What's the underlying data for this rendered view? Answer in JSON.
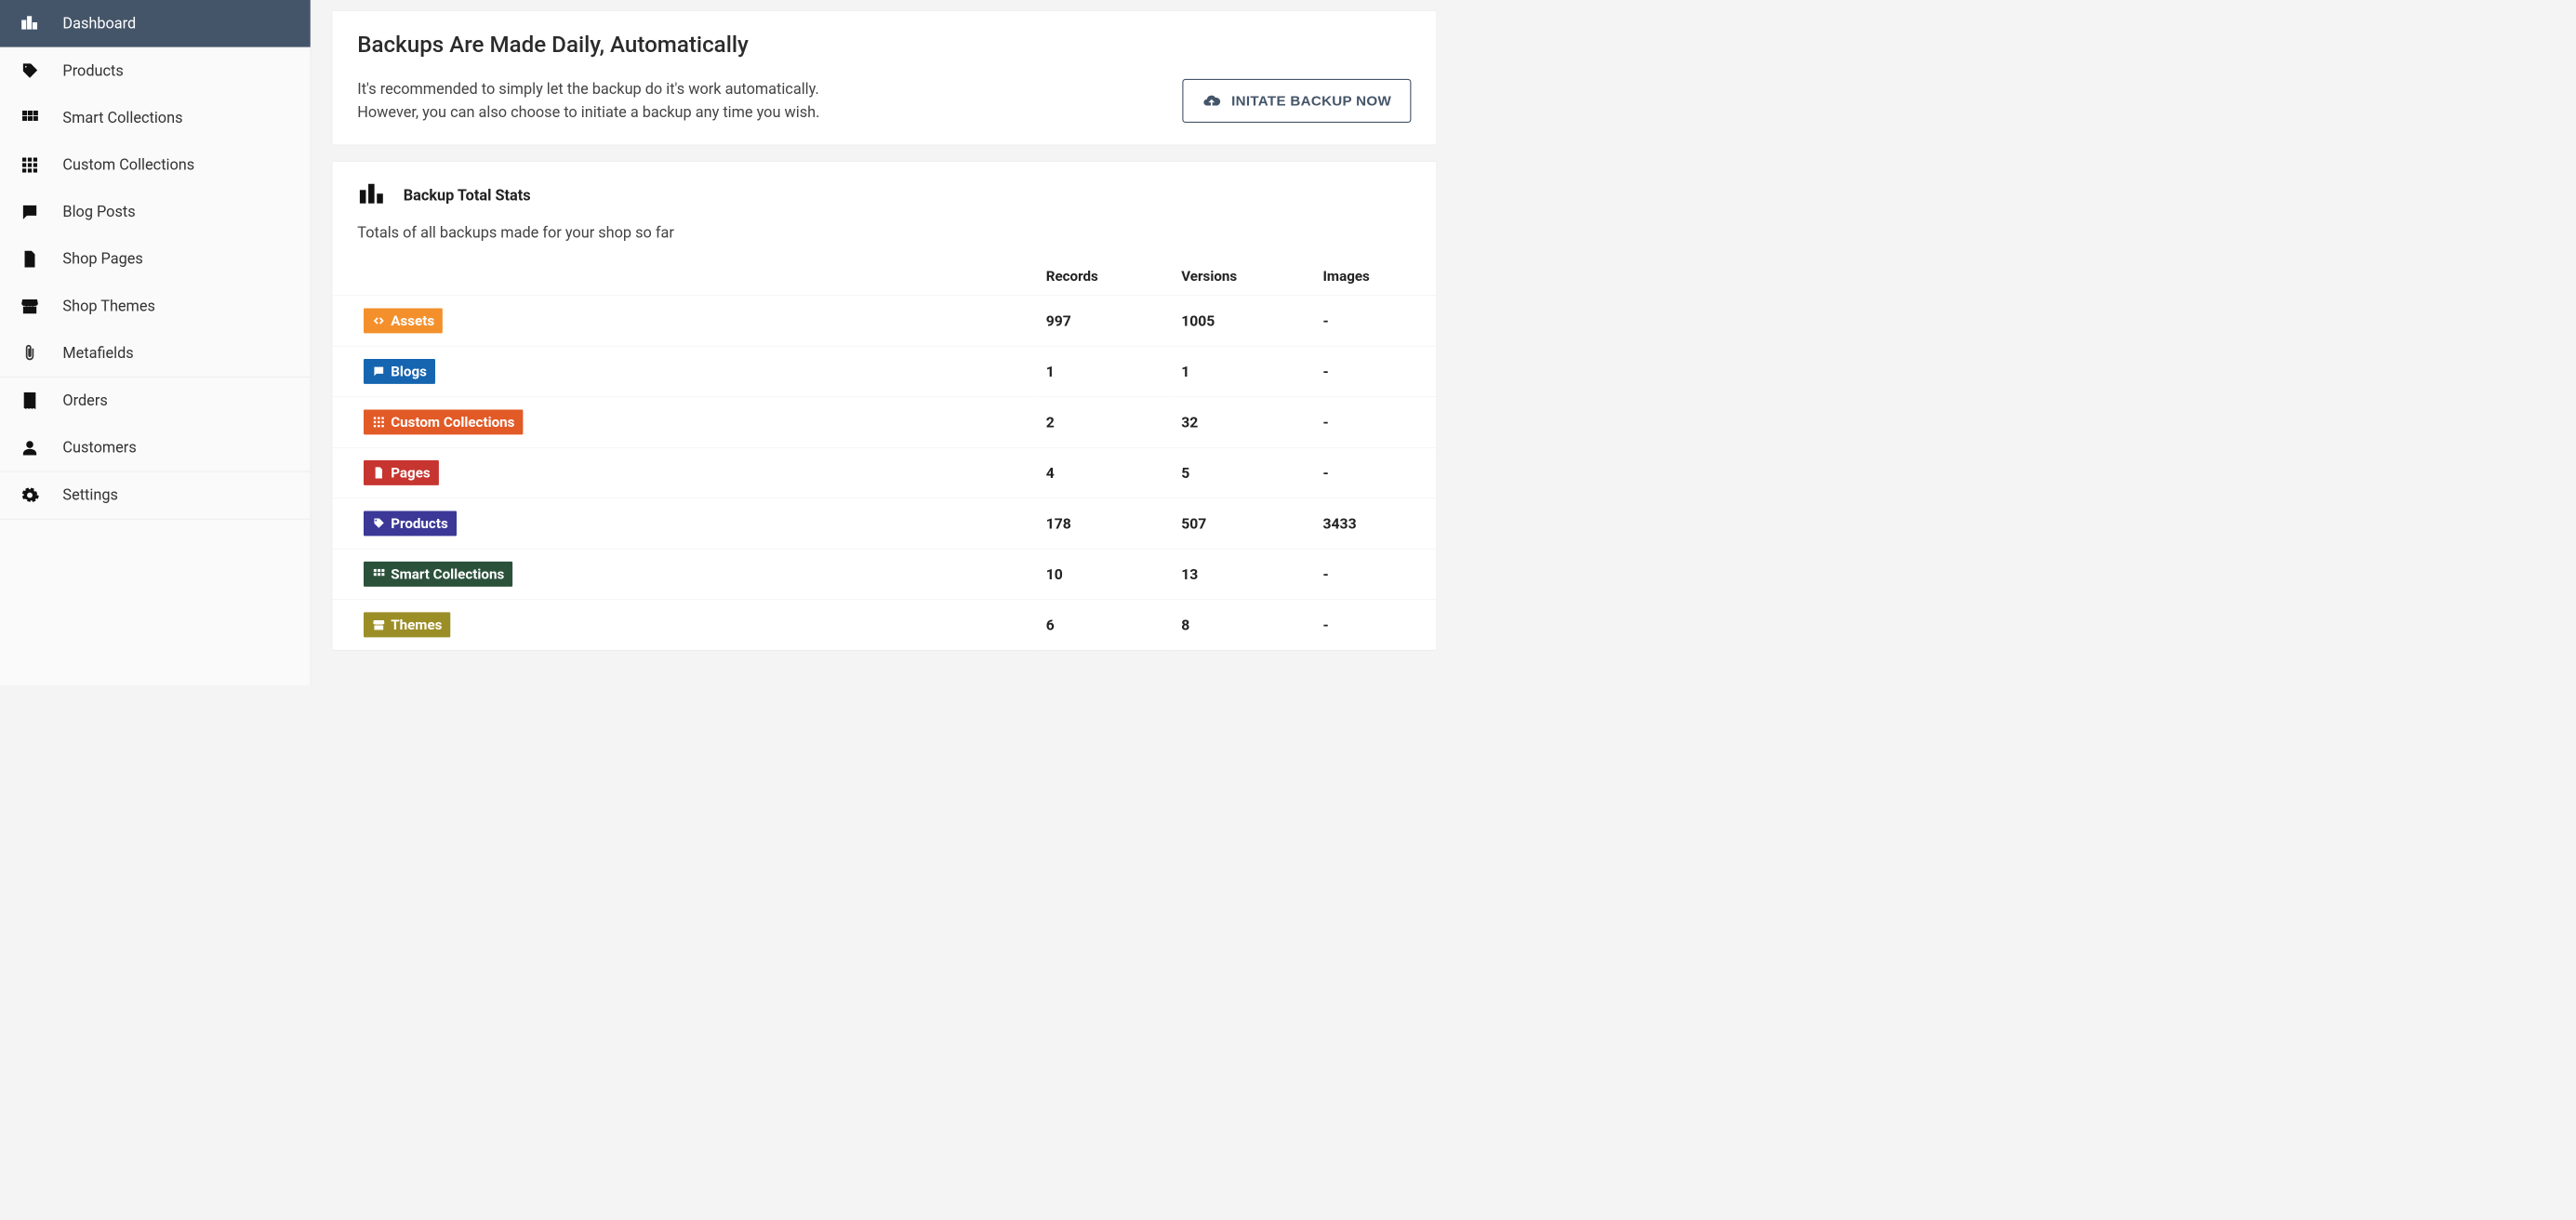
{
  "sidebar": {
    "items": [
      {
        "id": "dashboard",
        "label": "Dashboard",
        "icon": "bars-icon",
        "active": true,
        "group": 0
      },
      {
        "id": "products",
        "label": "Products",
        "icon": "tag-icon",
        "group": 1
      },
      {
        "id": "smart-collections",
        "label": "Smart Collections",
        "icon": "grid-icon",
        "group": 1
      },
      {
        "id": "custom-collections",
        "label": "Custom Collections",
        "icon": "grid9-icon",
        "group": 1
      },
      {
        "id": "blog-posts",
        "label": "Blog Posts",
        "icon": "chat-icon",
        "group": 1
      },
      {
        "id": "shop-pages",
        "label": "Shop Pages",
        "icon": "page-icon",
        "group": 1
      },
      {
        "id": "shop-themes",
        "label": "Shop Themes",
        "icon": "store-icon",
        "group": 1
      },
      {
        "id": "metafields",
        "label": "Metafields",
        "icon": "paperclip-icon",
        "group": 1
      },
      {
        "id": "orders",
        "label": "Orders",
        "icon": "receipt-icon",
        "group": 2
      },
      {
        "id": "customers",
        "label": "Customers",
        "icon": "person-icon",
        "group": 2
      },
      {
        "id": "settings",
        "label": "Settings",
        "icon": "gear-icon",
        "group": 3
      }
    ]
  },
  "hero": {
    "title": "Backups Are Made Daily, Automatically",
    "desc_line1": "It's recommended to simply let the backup do it's work automatically.",
    "desc_line2": "However, you can also choose to initiate a backup any time you wish.",
    "button_label": "INITATE BACKUP NOW"
  },
  "stats": {
    "title": "Backup Total Stats",
    "subtitle": "Totals of all backups made for your shop so far",
    "columns": {
      "records": "Records",
      "versions": "Versions",
      "images": "Images"
    },
    "rows": [
      {
        "label": "Assets",
        "color": "#F4902C",
        "icon": "code-icon",
        "records": "997",
        "versions": "1005",
        "images": "-"
      },
      {
        "label": "Blogs",
        "color": "#1565B0",
        "icon": "chat-icon",
        "records": "1",
        "versions": "1",
        "images": "-"
      },
      {
        "label": "Custom Collections",
        "color": "#E25A26",
        "icon": "grid9-icon",
        "records": "2",
        "versions": "32",
        "images": "-"
      },
      {
        "label": "Pages",
        "color": "#C73530",
        "icon": "page-icon",
        "records": "4",
        "versions": "5",
        "images": "-"
      },
      {
        "label": "Products",
        "color": "#3B3897",
        "icon": "tag-icon",
        "records": "178",
        "versions": "507",
        "images": "3433"
      },
      {
        "label": "Smart Collections",
        "color": "#2B513B",
        "icon": "grid-icon",
        "records": "10",
        "versions": "13",
        "images": "-"
      },
      {
        "label": "Themes",
        "color": "#9C8E26",
        "icon": "store-icon",
        "records": "6",
        "versions": "8",
        "images": "-"
      }
    ]
  }
}
